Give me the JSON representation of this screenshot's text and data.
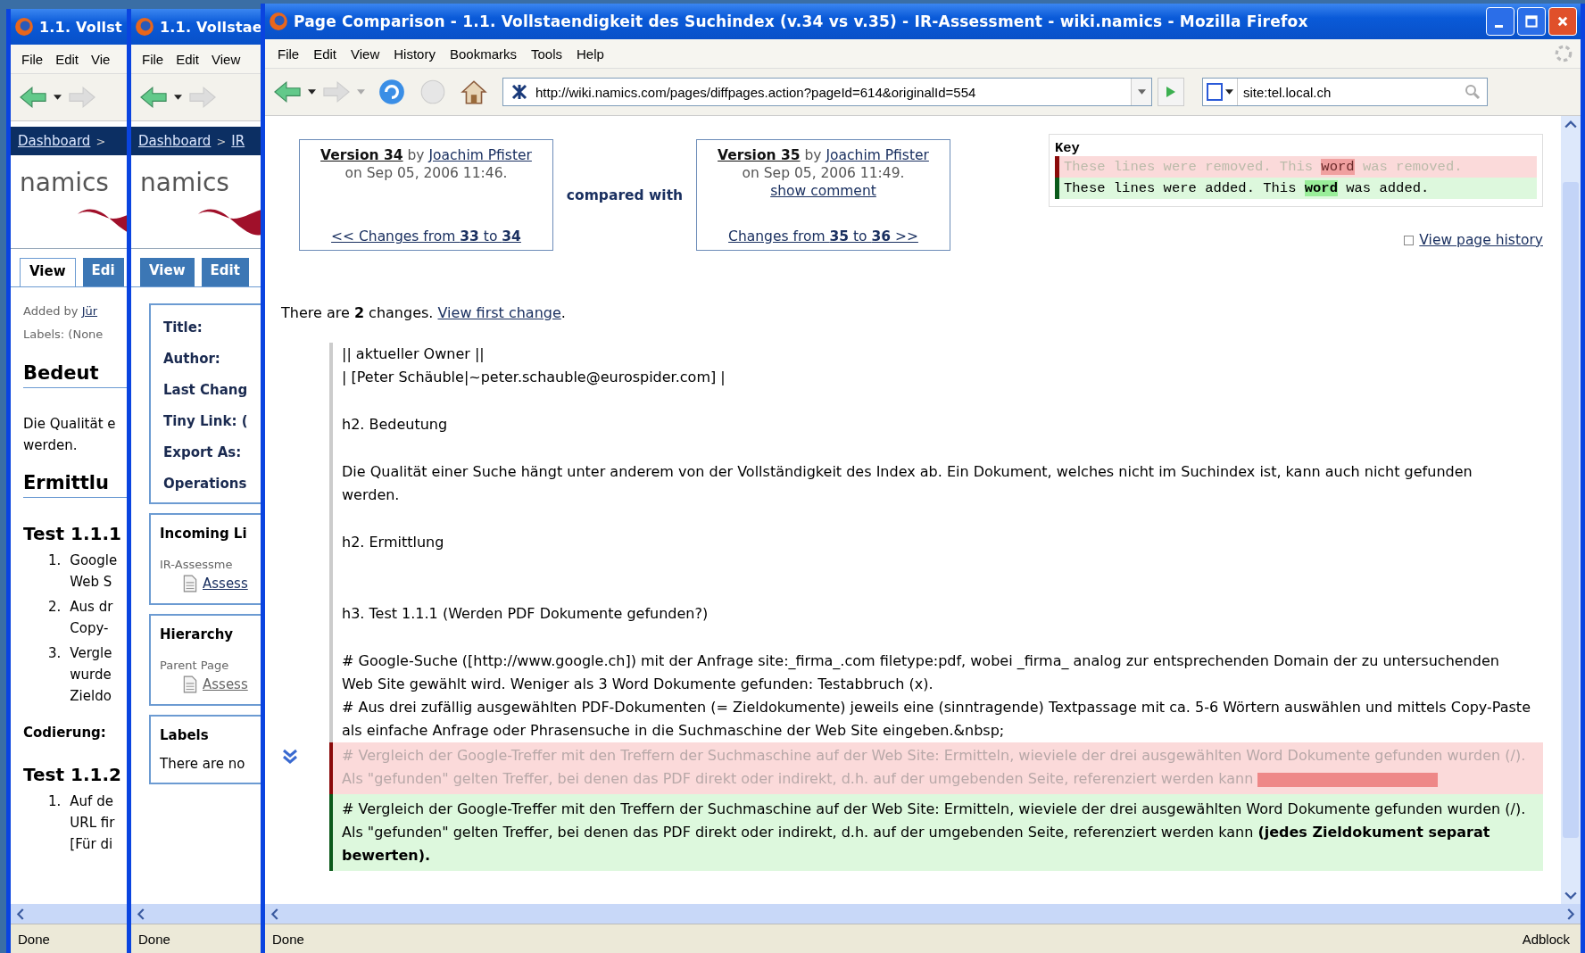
{
  "back_window": {
    "title": "1.1. Vollst",
    "menu": [
      "File",
      "Edit",
      "Vie"
    ],
    "breadcrumb": {
      "link": "Dashboard",
      "separator": ">"
    },
    "logo": "namics",
    "tabs": [
      {
        "label": "View",
        "selected": true
      },
      {
        "label": "Edi",
        "selected": false
      }
    ],
    "meta": [
      {
        "label": "Added by",
        "link": "Jür"
      },
      {
        "label": "Labels: (None"
      }
    ],
    "content": [
      {
        "kind": "h2",
        "lines": [
          "Bedeut"
        ]
      },
      {
        "kind": "p",
        "lines": [
          "Die Qualität e",
          "werden."
        ]
      },
      {
        "kind": "h2",
        "lines": [
          "Ermittlu"
        ]
      },
      {
        "kind": "h3",
        "lines": [
          "Test 1.1.1"
        ]
      },
      {
        "kind": "item",
        "number": "1.",
        "lines": [
          "Google",
          "Web S"
        ]
      },
      {
        "kind": "item",
        "number": "2.",
        "lines": [
          "Aus dr",
          "Copy-"
        ]
      },
      {
        "kind": "item",
        "number": "3.",
        "lines": [
          "Vergle",
          "wurde",
          "Zieldo"
        ]
      },
      {
        "kind": "strong",
        "lines": [
          "Codierung:"
        ]
      },
      {
        "kind": "h3",
        "lines": [
          "Test 1.1.2"
        ]
      },
      {
        "kind": "item",
        "number": "1.",
        "lines": [
          "Auf de",
          "URL fir",
          "[Für di"
        ]
      }
    ],
    "status": "Done"
  },
  "middle_window": {
    "title": "1.1. Vollstae",
    "menu": [
      "File",
      "Edit",
      "View"
    ],
    "breadcrumb": {
      "link": "Dashboard",
      "separator": ">",
      "next": "IR"
    },
    "logo": "namics",
    "tabs": [
      {
        "label": "View",
        "selected": false
      },
      {
        "label": "Edit",
        "selected": false
      }
    ],
    "info_fields": [
      "Title:",
      "Author:",
      "Last Chang",
      "Tiny Link: (",
      "Export As:",
      "Operations"
    ],
    "incoming_links": {
      "heading": "Incoming Li",
      "space": "IR-Assessme",
      "link": "Assess"
    },
    "hierarchy": {
      "heading": "Hierarchy",
      "label": "Parent Page",
      "link": "Assess"
    },
    "labels": {
      "heading": "Labels",
      "text": "There are no"
    },
    "status": "Done"
  },
  "main_window": {
    "title": "Page Comparison - 1.1. Vollstaendigkeit des Suchindex (v.34 vs v.35) - IR-Assessment - wiki.namics - Mozilla Firefox",
    "menu": [
      "File",
      "Edit",
      "View",
      "History",
      "Bookmarks",
      "Tools",
      "Help"
    ],
    "url": "http://wiki.namics.com/pages/diffpages.action?pageId=614&originalId=554",
    "search": "site:tel.local.ch",
    "versions": [
      {
        "link": "Version 34",
        "by": "by",
        "author": "Joachim Pfister",
        "date": "on Sep 05, 2006 11:46.",
        "nav": "<< Changes from **33** to **34**"
      },
      {
        "link": "Version 35",
        "by": "by",
        "author": "Joachim Pfister",
        "date": "on Sep 05, 2006 11:49.",
        "comment": "show comment",
        "nav": "Changes from **35** to **36** >>"
      }
    ],
    "compared": "compared with",
    "key": {
      "heading": "Key",
      "lines": [
        {
          "kind": "removed",
          "before": "These lines were removed. This",
          "word": "word",
          "after": "was removed."
        },
        {
          "kind": "added",
          "before": "These lines were added. This",
          "word": "word",
          "after": "was added."
        }
      ]
    },
    "history_link": "View page history",
    "summary": {
      "text": "There are **2** changes.",
      "link": "View first change",
      "end": "."
    },
    "diff": [
      {
        "kind": "same",
        "text": "|| aktueller Owner ||"
      },
      {
        "kind": "same",
        "text": "| [Peter Schäuble|~peter.schauble@eurospider.com] |"
      },
      {
        "kind": "blank"
      },
      {
        "kind": "same",
        "text": "h2. Bedeutung"
      },
      {
        "kind": "blank"
      },
      {
        "kind": "same",
        "text": "Die Qualität einer Suche hängt unter anderem von der Vollständigkeit des Index ab. Ein Dokument, welches nicht im Suchindex ist, kann auch nicht gefunden werden."
      },
      {
        "kind": "blank"
      },
      {
        "kind": "same",
        "text": "h2. Ermittlung"
      },
      {
        "kind": "blank"
      },
      {
        "kind": "blank"
      },
      {
        "kind": "same",
        "text": "h3. Test 1.1.1 (Werden PDF Dokumente gefunden?)"
      },
      {
        "kind": "blank"
      },
      {
        "kind": "same",
        "text": "# Google-Suche ([http://www.google.ch]) mit der Anfrage site:_firma_.com filetype:pdf, wobei _firma_ analog zur entsprechenden Domain der zu untersuchenden Web Site gewählt wird. Weniger als 3 Word Dokumente gefunden: Testabbruch (x)."
      },
      {
        "kind": "same",
        "text": "# Aus drei zufällig ausgewählten PDF-Dokumenten (= Zieldokumente) jeweils eine (sinntragende) Textpassage mit ca. 5-6 Wörtern auswählen und mittels Copy-Paste als einfache Anfrage oder Phrasensuche in die Suchmaschine der Web Site eingeben.&nbsp;"
      },
      {
        "kind": "removed",
        "text": "# Vergleich der Google-Treffer mit den Treffern der Suchmaschine auf der Web Site: Ermitteln, wieviele der drei ausgewählten Word Dokumente gefunden wurden (/). Als \"gefunden\" gelten Treffer, bei denen das PDF direkt oder indirekt, d.h. auf der umgebenden Seite, referenziert werden kann"
      },
      {
        "kind": "added",
        "text": "# Vergleich der Google-Treffer mit den Treffern der Suchmaschine auf der Web Site: Ermitteln, wieviele der drei ausgewählten Word Dokumente gefunden wurden (/). Als \"gefunden\" gelten Treffer, bei denen das PDF direkt oder indirekt, d.h. auf der umgebenden Seite, referenziert werden kann **(jedes Zieldokument separat bewerten).**"
      }
    ],
    "status": "Done",
    "status_right": "Adblock"
  }
}
